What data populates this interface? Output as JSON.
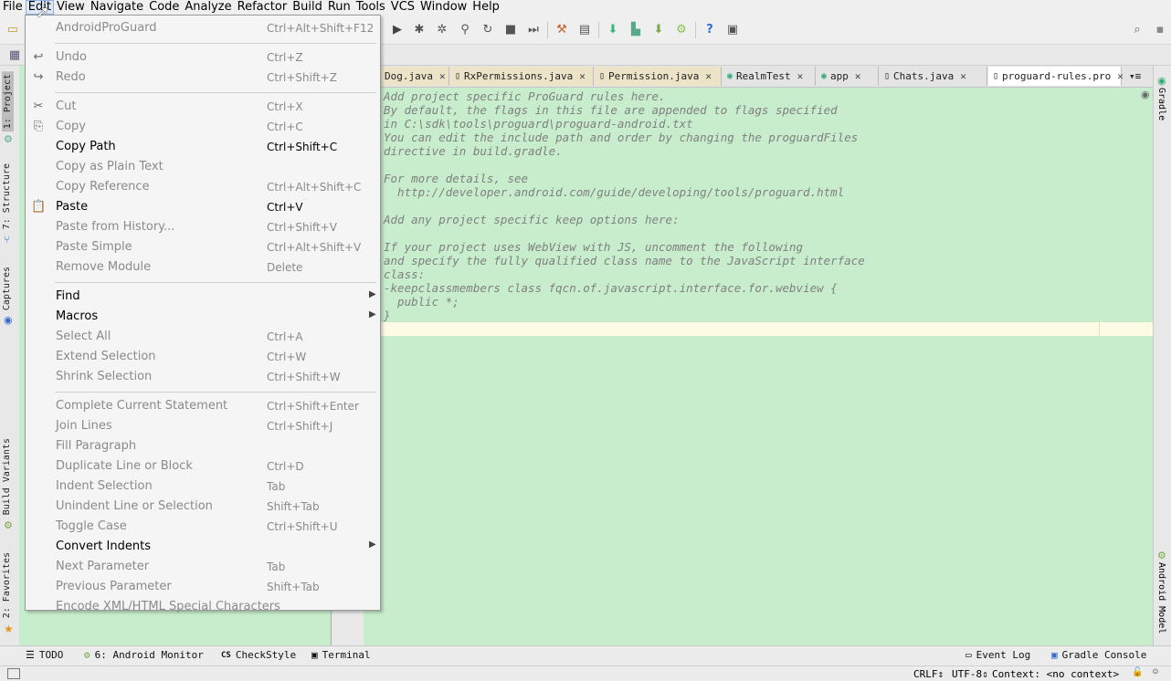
{
  "menubar": {
    "items": [
      "File",
      "Edit",
      "View",
      "Navigate",
      "Code",
      "Analyze",
      "Refactor",
      "Build",
      "Run",
      "Tools",
      "VCS",
      "Window",
      "Help"
    ]
  },
  "tabs": [
    {
      "label": "Dog.java"
    },
    {
      "label": "RxPermissions.java"
    },
    {
      "label": "Permission.java"
    },
    {
      "label": "RealmTest"
    },
    {
      "label": "app"
    },
    {
      "label": "Chats.java"
    },
    {
      "label": "proguard-rules.pro"
    }
  ],
  "left_strip": {
    "project": "1: Project",
    "structure": "7: Structure",
    "captures": "Captures",
    "build_variants": "Build Variants",
    "favorites": "2: Favorites"
  },
  "right_strip": {
    "gradle": "Gradle",
    "android_model": "Android Model"
  },
  "editor": {
    "lines": [
      "Add project specific ProGuard rules here.",
      "By default, the flags in this file are appended to flags specified",
      "in C:\\sdk\\tools\\proguard\\proguard-android.txt",
      "You can edit the include path and order by changing the proguardFiles",
      "directive in build.gradle.",
      "",
      "For more details, see",
      "  http://developer.android.com/guide/developing/tools/proguard.html",
      "",
      "Add any project specific keep options here:",
      "",
      "If your project uses WebView with JS, uncomment the following",
      "and specify the fully qualified class name to the JavaScript interface",
      "class:",
      "-keepclassmembers class fqcn.of.javascript.interface.for.webview {",
      "  public *;",
      "}"
    ]
  },
  "edit_menu": {
    "items": [
      {
        "label": "AndroidProGuard",
        "shortcut": "Ctrl+Alt+Shift+F12",
        "disabled": true
      },
      {
        "label": "Undo",
        "shortcut": "Ctrl+Z",
        "disabled": true
      },
      {
        "label": "Redo",
        "shortcut": "Ctrl+Shift+Z",
        "disabled": true
      },
      {
        "label": "Cut",
        "shortcut": "Ctrl+X",
        "disabled": true
      },
      {
        "label": "Copy",
        "shortcut": "Ctrl+C",
        "disabled": true
      },
      {
        "label": "Copy Path",
        "shortcut": "Ctrl+Shift+C",
        "disabled": false
      },
      {
        "label": "Copy as Plain Text",
        "shortcut": "",
        "disabled": true
      },
      {
        "label": "Copy Reference",
        "shortcut": "Ctrl+Alt+Shift+C",
        "disabled": true
      },
      {
        "label": "Paste",
        "shortcut": "Ctrl+V",
        "disabled": false
      },
      {
        "label": "Paste from History...",
        "shortcut": "Ctrl+Shift+V",
        "disabled": true
      },
      {
        "label": "Paste Simple",
        "shortcut": "Ctrl+Alt+Shift+V",
        "disabled": true
      },
      {
        "label": "Remove Module",
        "shortcut": "Delete",
        "disabled": true
      },
      {
        "label": "Find",
        "shortcut": "",
        "disabled": false,
        "submenu": true
      },
      {
        "label": "Macros",
        "shortcut": "",
        "disabled": false,
        "submenu": true
      },
      {
        "label": "Select All",
        "shortcut": "Ctrl+A",
        "disabled": true
      },
      {
        "label": "Extend Selection",
        "shortcut": "Ctrl+W",
        "disabled": true
      },
      {
        "label": "Shrink Selection",
        "shortcut": "Ctrl+Shift+W",
        "disabled": true
      },
      {
        "label": "Complete Current Statement",
        "shortcut": "Ctrl+Shift+Enter",
        "disabled": true
      },
      {
        "label": "Join Lines",
        "shortcut": "Ctrl+Shift+J",
        "disabled": true
      },
      {
        "label": "Fill Paragraph",
        "shortcut": "",
        "disabled": true
      },
      {
        "label": "Duplicate Line or Block",
        "shortcut": "Ctrl+D",
        "disabled": true
      },
      {
        "label": "Indent Selection",
        "shortcut": "Tab",
        "disabled": true
      },
      {
        "label": "Unindent Line or Selection",
        "shortcut": "Shift+Tab",
        "disabled": true
      },
      {
        "label": "Toggle Case",
        "shortcut": "Ctrl+Shift+U",
        "disabled": true
      },
      {
        "label": "Convert Indents",
        "shortcut": "",
        "disabled": false,
        "submenu": true
      },
      {
        "label": "Next Parameter",
        "shortcut": "Tab",
        "disabled": true
      },
      {
        "label": "Previous Parameter",
        "shortcut": "Shift+Tab",
        "disabled": true
      },
      {
        "label": "Encode XML/HTML Special Characters",
        "shortcut": "",
        "disabled": true
      }
    ]
  },
  "bottom_tools": {
    "todo": "TODO",
    "android_monitor": "6: Android Monitor",
    "checkstyle": "CheckStyle",
    "terminal": "Terminal",
    "event_log": "Event Log",
    "gradle_console": "Gradle Console"
  },
  "status": {
    "line_sep": "CRLF",
    "encoding": "UTF-8",
    "context": "Context: <no context>"
  },
  "colors": {
    "editor_bg": "#c7edcc",
    "comment": "#808080"
  }
}
